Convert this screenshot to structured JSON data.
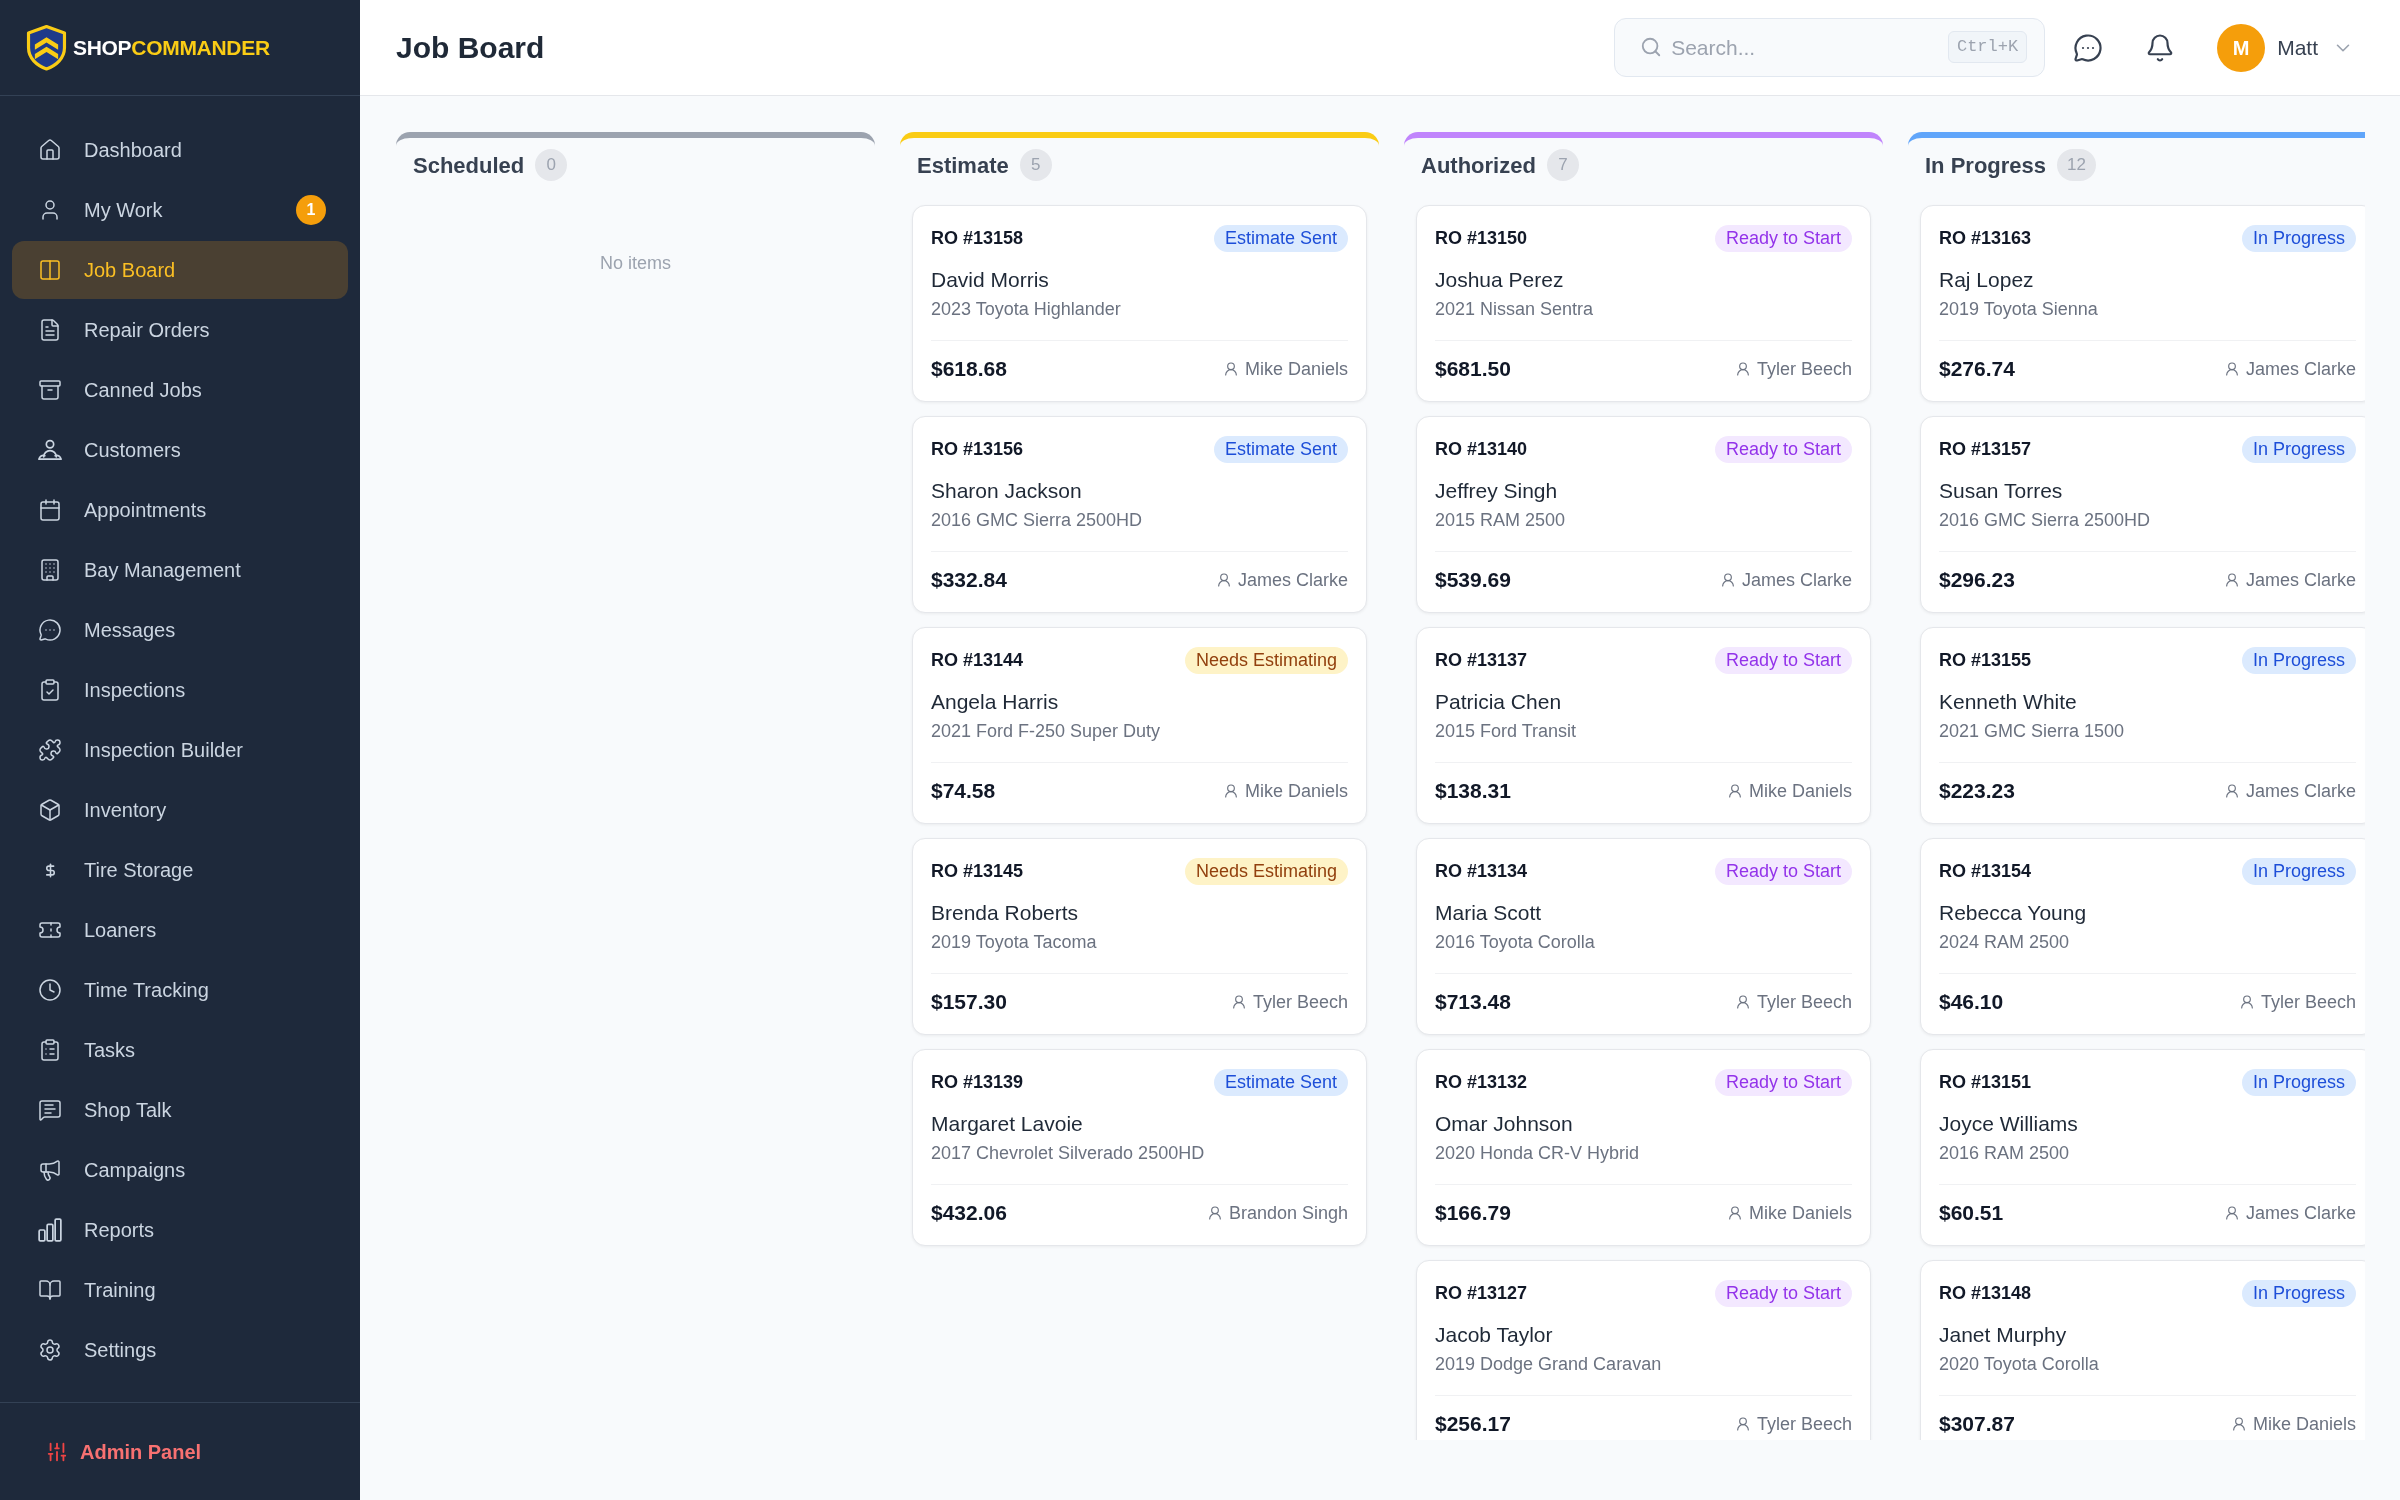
{
  "sidebar": {
    "logo": {
      "primary": "SHOP",
      "accent": "COMMANDER"
    },
    "items": [
      {
        "label": "Dashboard",
        "selected": false
      },
      {
        "label": "My Work",
        "selected": false,
        "badge": "1"
      },
      {
        "label": "Job Board",
        "selected": true
      },
      {
        "label": "Repair Orders",
        "selected": false
      },
      {
        "label": "Canned Jobs",
        "selected": false
      },
      {
        "label": "Customers",
        "selected": false
      },
      {
        "label": "Appointments",
        "selected": false
      },
      {
        "label": "Bay Management",
        "selected": false
      },
      {
        "label": "Messages",
        "selected": false
      },
      {
        "label": "Inspections",
        "selected": false
      },
      {
        "label": "Inspection Builder",
        "selected": false
      },
      {
        "label": "Inventory",
        "selected": false
      },
      {
        "label": "Tire Storage",
        "selected": false
      },
      {
        "label": "Loaners",
        "selected": false
      },
      {
        "label": "Time Tracking",
        "selected": false
      },
      {
        "label": "Tasks",
        "selected": false
      },
      {
        "label": "Shop Talk",
        "selected": false
      },
      {
        "label": "Campaigns",
        "selected": false
      },
      {
        "label": "Reports",
        "selected": false
      },
      {
        "label": "Training",
        "selected": false
      },
      {
        "label": "Settings",
        "selected": false
      }
    ],
    "footer_item": {
      "label": "Admin Panel"
    }
  },
  "header": {
    "title": "Job Board",
    "search": {
      "placeholder": "Search...",
      "shortcut": "Ctrl+K"
    },
    "user": {
      "initial": "M",
      "name": "Matt"
    }
  },
  "board": {
    "columns": [
      {
        "title": "Scheduled",
        "count": "0",
        "color": "#9ca3af",
        "empty_text": "No items"
      },
      {
        "title": "Estimate",
        "count": "5",
        "color": "#facc15",
        "cards": [
          {
            "ro": "RO #13158",
            "status": {
              "label": "Estimate Sent",
              "kind": "sent"
            },
            "customer": "David Morris",
            "vehicle": "2023 Toyota Highlander",
            "amount": "$618.68",
            "assignee": "Mike Daniels"
          },
          {
            "ro": "RO #13156",
            "status": {
              "label": "Estimate Sent",
              "kind": "sent"
            },
            "customer": "Sharon Jackson",
            "vehicle": "2016 GMC Sierra 2500HD",
            "amount": "$332.84",
            "assignee": "James Clarke"
          },
          {
            "ro": "RO #13144",
            "status": {
              "label": "Needs Estimating",
              "kind": "estimating"
            },
            "customer": "Angela Harris",
            "vehicle": "2021 Ford F-250 Super Duty",
            "amount": "$74.58",
            "assignee": "Mike Daniels"
          },
          {
            "ro": "RO #13145",
            "status": {
              "label": "Needs Estimating",
              "kind": "estimating"
            },
            "customer": "Brenda Roberts",
            "vehicle": "2019 Toyota Tacoma",
            "amount": "$157.30",
            "assignee": "Tyler Beech"
          },
          {
            "ro": "RO #13139",
            "status": {
              "label": "Estimate Sent",
              "kind": "sent"
            },
            "customer": "Margaret Lavoie",
            "vehicle": "2017 Chevrolet Silverado 2500HD",
            "amount": "$432.06",
            "assignee": "Brandon Singh"
          }
        ]
      },
      {
        "title": "Authorized",
        "count": "7",
        "color": "#c084fc",
        "cards": [
          {
            "ro": "RO #13150",
            "status": {
              "label": "Ready to Start",
              "kind": "ready"
            },
            "customer": "Joshua Perez",
            "vehicle": "2021 Nissan Sentra",
            "amount": "$681.50",
            "assignee": "Tyler Beech"
          },
          {
            "ro": "RO #13140",
            "status": {
              "label": "Ready to Start",
              "kind": "ready"
            },
            "customer": "Jeffrey Singh",
            "vehicle": "2015 RAM 2500",
            "amount": "$539.69",
            "assignee": "James Clarke"
          },
          {
            "ro": "RO #13137",
            "status": {
              "label": "Ready to Start",
              "kind": "ready"
            },
            "customer": "Patricia Chen",
            "vehicle": "2015 Ford Transit",
            "amount": "$138.31",
            "assignee": "Mike Daniels"
          },
          {
            "ro": "RO #13134",
            "status": {
              "label": "Ready to Start",
              "kind": "ready"
            },
            "customer": "Maria Scott",
            "vehicle": "2016 Toyota Corolla",
            "amount": "$713.48",
            "assignee": "Tyler Beech"
          },
          {
            "ro": "RO #13132",
            "status": {
              "label": "Ready to Start",
              "kind": "ready"
            },
            "customer": "Omar Johnson",
            "vehicle": "2020 Honda CR-V Hybrid",
            "amount": "$166.79",
            "assignee": "Mike Daniels"
          },
          {
            "ro": "RO #13127",
            "status": {
              "label": "Ready to Start",
              "kind": "ready"
            },
            "customer": "Jacob Taylor",
            "vehicle": "2019 Dodge Grand Caravan",
            "amount": "$256.17",
            "assignee": "Tyler Beech"
          }
        ]
      },
      {
        "title": "In Progress",
        "count": "12",
        "color": "#60a5fa",
        "cards": [
          {
            "ro": "RO #13163",
            "status": {
              "label": "In Progress",
              "kind": "progress"
            },
            "customer": "Raj Lopez",
            "vehicle": "2019 Toyota Sienna",
            "amount": "$276.74",
            "assignee": "James Clarke"
          },
          {
            "ro": "RO #13157",
            "status": {
              "label": "In Progress",
              "kind": "progress"
            },
            "customer": "Susan Torres",
            "vehicle": "2016 GMC Sierra 2500HD",
            "amount": "$296.23",
            "assignee": "James Clarke"
          },
          {
            "ro": "RO #13155",
            "status": {
              "label": "In Progress",
              "kind": "progress"
            },
            "customer": "Kenneth White",
            "vehicle": "2021 GMC Sierra 1500",
            "amount": "$223.23",
            "assignee": "James Clarke"
          },
          {
            "ro": "RO #13154",
            "status": {
              "label": "In Progress",
              "kind": "progress"
            },
            "customer": "Rebecca Young",
            "vehicle": "2024 RAM 2500",
            "amount": "$46.10",
            "assignee": "Tyler Beech"
          },
          {
            "ro": "RO #13151",
            "status": {
              "label": "In Progress",
              "kind": "progress"
            },
            "customer": "Joyce Williams",
            "vehicle": "2016 RAM 2500",
            "amount": "$60.51",
            "assignee": "James Clarke"
          },
          {
            "ro": "RO #13148",
            "status": {
              "label": "In Progress",
              "kind": "progress"
            },
            "customer": "Janet Murphy",
            "vehicle": "2020 Toyota Corolla",
            "amount": "$307.87",
            "assignee": "Mike Daniels"
          }
        ]
      }
    ]
  }
}
